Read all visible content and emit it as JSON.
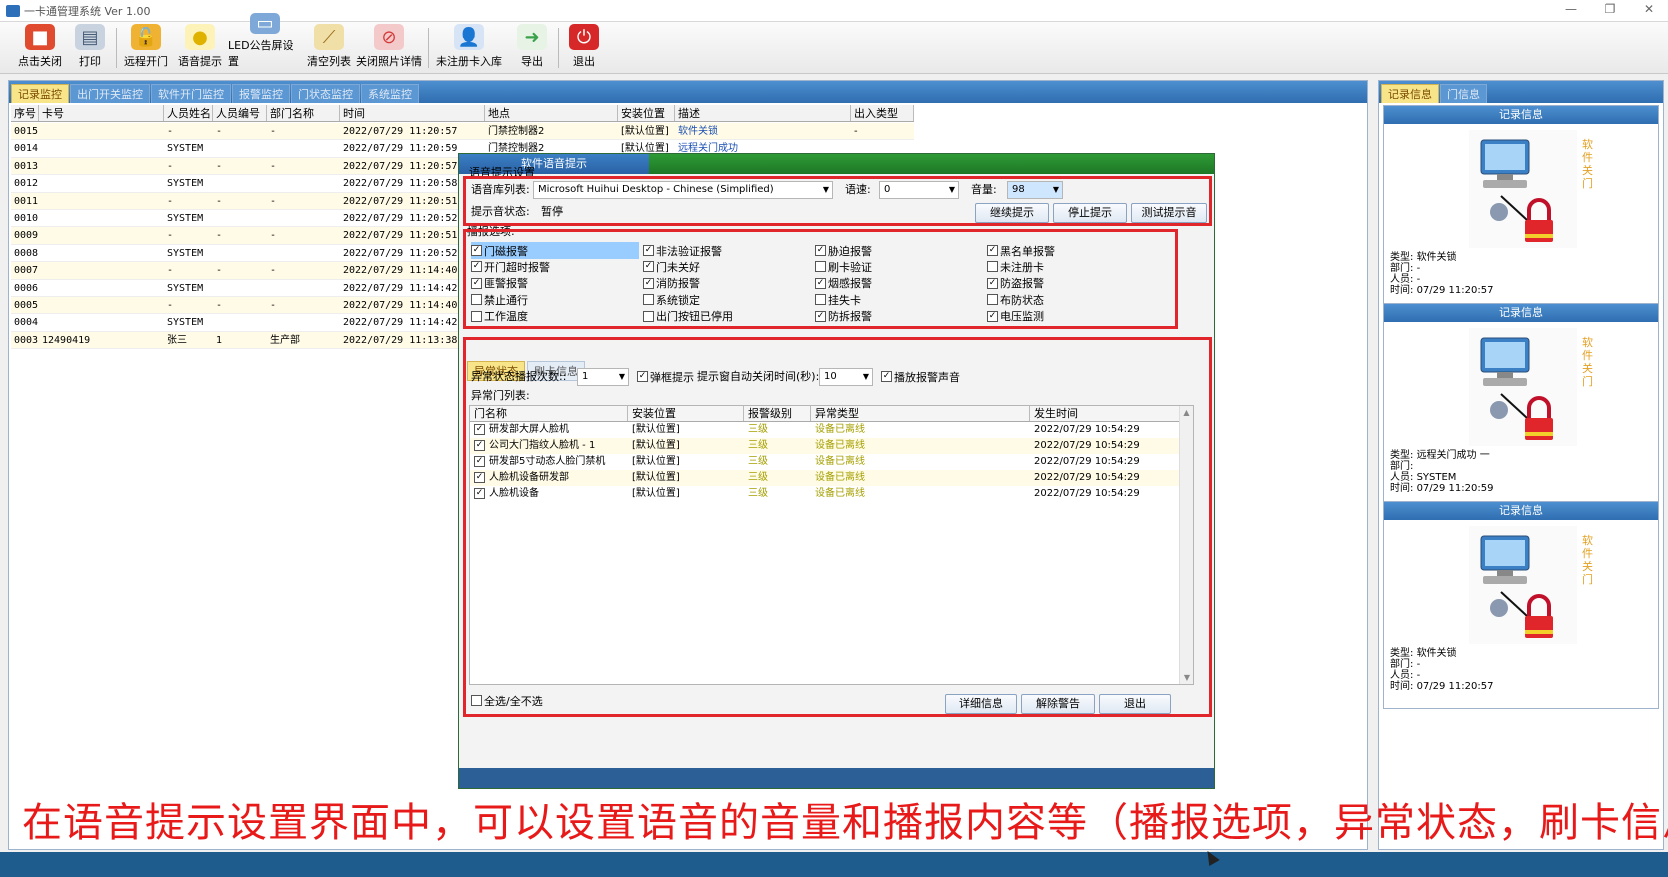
{
  "window": {
    "title": "一卡通管理系统  Ver 1.00"
  },
  "toolbar": [
    {
      "label": "点击关闭",
      "icon": "open-door-icon",
      "color": "#e04b2f"
    },
    {
      "label": "打印",
      "icon": "printer-icon",
      "color": "#6e8fb7"
    },
    {
      "label": "远程开门",
      "icon": "unlock-icon",
      "color": "#e3a022"
    },
    {
      "label": "语音提示",
      "icon": "lightbulb-icon",
      "color": "#f2cc3c"
    },
    {
      "label": "LED公告屏设置",
      "icon": "monitor-icon",
      "color": "#4f86c6"
    },
    {
      "label": "清空列表",
      "icon": "broom-icon",
      "color": "#c99a3a"
    },
    {
      "label": "关闭照片详情",
      "icon": "no-photo-icon",
      "color": "#d33b3b"
    },
    {
      "label": "未注册卡入库",
      "icon": "user-card-icon",
      "color": "#3f73b8"
    },
    {
      "label": "导出",
      "icon": "export-icon",
      "color": "#3aa24a"
    },
    {
      "label": "退出",
      "icon": "power-icon",
      "color": "#d62828"
    }
  ],
  "left_tabs": [
    "记录监控",
    "出门开关监控",
    "软件开门监控",
    "报警监控",
    "门状态监控",
    "系统监控"
  ],
  "grid": {
    "columns": [
      "序号",
      "卡号",
      "人员姓名",
      "人员编号",
      "部门名称",
      "时间",
      "地点",
      "安装位置",
      "描述",
      "出入类型"
    ],
    "rows": [
      [
        "0015",
        "",
        "-",
        "-",
        "-",
        "2022/07/29 11:20:57",
        "门禁控制器2",
        "[默认位置]",
        "软件关锁",
        "-"
      ],
      [
        "0014",
        "",
        "SYSTEM",
        "",
        "",
        "2022/07/29 11:20:59",
        "门禁控制器2",
        "[默认位置]",
        "远程关门成功",
        ""
      ],
      [
        "0013",
        "",
        "-",
        "-",
        "-",
        "2022/07/29 11:20:57",
        "",
        "",
        "",
        ""
      ],
      [
        "0012",
        "",
        "SYSTEM",
        "",
        "",
        "2022/07/29 11:20:58",
        "",
        "",
        "",
        ""
      ],
      [
        "0011",
        "",
        "-",
        "-",
        "-",
        "2022/07/29 11:20:51",
        "",
        "",
        "",
        ""
      ],
      [
        "0010",
        "",
        "SYSTEM",
        "",
        "",
        "2022/07/29 11:20:52",
        "",
        "",
        "",
        ""
      ],
      [
        "0009",
        "",
        "-",
        "-",
        "-",
        "2022/07/29 11:20:51",
        "",
        "",
        "",
        ""
      ],
      [
        "0008",
        "",
        "SYSTEM",
        "",
        "",
        "2022/07/29 11:20:52",
        "",
        "",
        "",
        ""
      ],
      [
        "0007",
        "",
        "-",
        "-",
        "-",
        "2022/07/29 11:14:40",
        "",
        "",
        "",
        ""
      ],
      [
        "0006",
        "",
        "SYSTEM",
        "",
        "",
        "2022/07/29 11:14:42",
        "",
        "",
        "",
        ""
      ],
      [
        "0005",
        "",
        "-",
        "-",
        "-",
        "2022/07/29 11:14:40",
        "",
        "",
        "",
        ""
      ],
      [
        "0004",
        "",
        "SYSTEM",
        "",
        "",
        "2022/07/29 11:14:42",
        "",
        "",
        "",
        ""
      ],
      [
        "0003",
        "12490419",
        "张三",
        "1",
        "生产部",
        "2022/07/29 11:13:38",
        "",
        "",
        "",
        ""
      ]
    ]
  },
  "right_tabs": [
    "记录信息",
    "门信息"
  ],
  "records": [
    {
      "header": "记录信息",
      "side_text": "软件关门",
      "type_label": "类型:",
      "type": "软件关锁",
      "dept_label": "部门:",
      "dept": "-",
      "person_label": "人员:",
      "person": "-",
      "time_label": "时间:",
      "time": "07/29 11:20:57"
    },
    {
      "header": "记录信息",
      "side_text": "软件关门",
      "type_label": "类型:",
      "type": "远程关门成功 一",
      "dept_label": "部门:",
      "dept": "",
      "person_label": "人员:",
      "person": "SYSTEM",
      "time_label": "时间:",
      "time": "07/29 11:20:59"
    },
    {
      "header": "记录信息",
      "side_text": "软件关门",
      "type_label": "类型:",
      "type": "软件关锁",
      "dept_label": "部门:",
      "dept": "-",
      "person_label": "人员:",
      "person": "-",
      "time_label": "时间:",
      "time": "07/29 11:20:57"
    }
  ],
  "dialog": {
    "title": "软件语音提示",
    "section_title": "语音提示设置",
    "voice_label": "语音库列表:",
    "voice_value": "Microsoft Huihui Desktop - Chinese (Simplified)",
    "speed_label": "语速:",
    "speed_value": "0",
    "volume_label": "音量:",
    "volume_value": "98",
    "status_label": "提示音状态:",
    "status_value": "暂停",
    "btn_continue": "继续提示",
    "btn_stop": "停止提示",
    "btn_test": "测试提示音",
    "options_title": "播报选项:",
    "options": [
      {
        "label": "门磁报警",
        "checked": true,
        "highlight": true
      },
      {
        "label": "非法验证报警",
        "checked": true
      },
      {
        "label": "胁迫报警",
        "checked": true
      },
      {
        "label": "黑名单报警",
        "checked": true
      },
      {
        "label": "开门超时报警",
        "checked": true
      },
      {
        "label": "门未关好",
        "checked": true
      },
      {
        "label": "刷卡验证",
        "checked": false
      },
      {
        "label": "未注册卡",
        "checked": false
      },
      {
        "label": "匪警报警",
        "checked": true
      },
      {
        "label": "消防报警",
        "checked": true
      },
      {
        "label": "烟感报警",
        "checked": true
      },
      {
        "label": "防盗报警",
        "checked": true
      },
      {
        "label": "禁止通行",
        "checked": false
      },
      {
        "label": "系统锁定",
        "checked": false
      },
      {
        "label": "挂失卡",
        "checked": false
      },
      {
        "label": "布防状态",
        "checked": false
      },
      {
        "label": "工作温度",
        "checked": false
      },
      {
        "label": "出门按钮已停用",
        "checked": false
      },
      {
        "label": "防拆报警",
        "checked": true
      },
      {
        "label": "电压监测",
        "checked": true
      }
    ],
    "sub_tabs": [
      "异常状态",
      "刷卡信息"
    ],
    "repeat_label": "异常状态播报次数::",
    "repeat_value": "1",
    "popup_label": "弹框提示",
    "autoclose_label": "提示窗自动关闭时间(秒):",
    "autoclose_value": "10",
    "play_sound_label": "播放报警声音",
    "list_title": "异常门列表:",
    "list_columns": [
      "门名称",
      "安装位置",
      "报警级别",
      "异常类型",
      "发生时间"
    ],
    "list_rows": [
      [
        "研发部大屏人脸机",
        "[默认位置]",
        "三级",
        "设备已离线",
        "2022/07/29 10:54:29"
      ],
      [
        "公司大门指纹人脸机 - 1",
        "[默认位置]",
        "三级",
        "设备已离线",
        "2022/07/29 10:54:29"
      ],
      [
        "研发部5寸动态人脸门禁机",
        "[默认位置]",
        "三级",
        "设备已离线",
        "2022/07/29 10:54:29"
      ],
      [
        "人脸机设备研发部",
        "[默认位置]",
        "三级",
        "设备已离线",
        "2022/07/29 10:54:29"
      ],
      [
        "人脸机设备",
        "[默认位置]",
        "三级",
        "设备已离线",
        "2022/07/29 10:54:29"
      ]
    ],
    "select_all_label": "全选/全不选",
    "btn_details": "详细信息",
    "btn_clear": "解除警告",
    "btn_exit": "退出"
  },
  "caption": "在语音提示设置界面中，可以设置语音的音量和播报内容等（播报选项，异常状态，刷卡信息）",
  "colors": {
    "accent_red": "#e0262a",
    "title_blue": "#2f6eb0",
    "dialog_green": "#1d7725",
    "caption_red": "#e81919"
  }
}
